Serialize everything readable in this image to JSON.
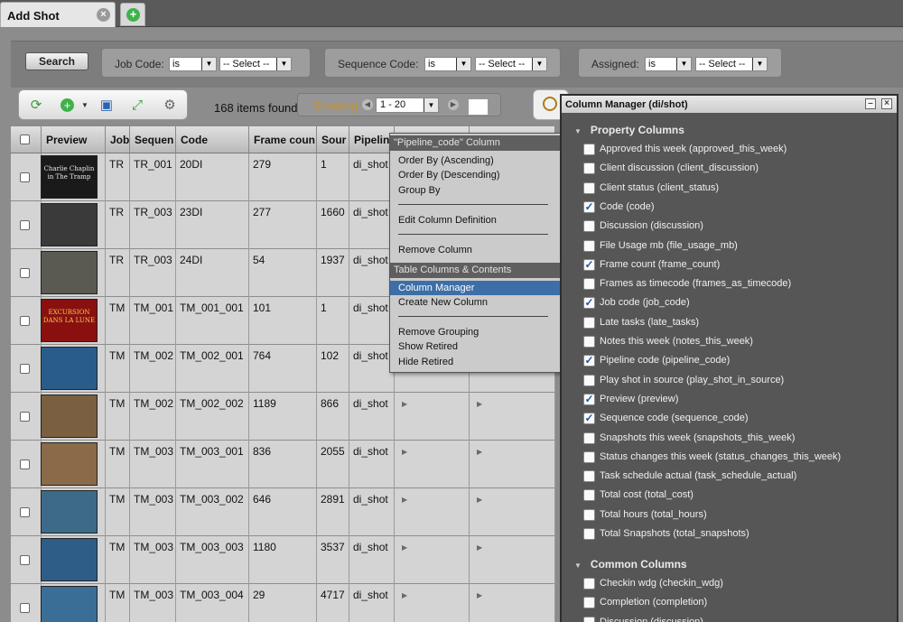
{
  "tabs": {
    "active_label": "Add Shot",
    "close_glyph": "×",
    "add_glyph": "+"
  },
  "search": {
    "button_label": "Search",
    "filters": [
      {
        "label": "Job Code:",
        "op": "is",
        "value": "-- Select --"
      },
      {
        "label": "Sequence Code:",
        "op": "is",
        "value": "-- Select --"
      },
      {
        "label": "Assigned:",
        "op": "is",
        "value": "-- Select --"
      }
    ]
  },
  "toolbar": {
    "items_found": "168 items found",
    "showing_label": "Showing",
    "range": "1 - 20",
    "icons": [
      "refresh-icon",
      "add-icon",
      "save-icon",
      "expand-icon",
      "gear-icon"
    ]
  },
  "table": {
    "headers": [
      "Preview",
      "Job",
      "Sequen",
      "Code",
      "Frame coun",
      "Sour",
      "Pipelin"
    ],
    "rows": [
      {
        "job": "TR",
        "seq": "TR_001",
        "code": "20DI",
        "frames": "279",
        "source": "1",
        "pipeline": "di_shot",
        "thumb": "#1a1a1a"
      },
      {
        "job": "TR",
        "seq": "TR_003",
        "code": "23DI",
        "frames": "277",
        "source": "1660",
        "pipeline": "di_shot",
        "thumb": "#3a3a3a"
      },
      {
        "job": "TR",
        "seq": "TR_003",
        "code": "24DI",
        "frames": "54",
        "source": "1937",
        "pipeline": "di_shot",
        "thumb": "#5a5a52"
      },
      {
        "job": "TM",
        "seq": "TM_001",
        "code": "TM_001_001",
        "frames": "101",
        "source": "1",
        "pipeline": "di_shot",
        "thumb": "#8a1010"
      },
      {
        "job": "TM",
        "seq": "TM_002",
        "code": "TM_002_001",
        "frames": "764",
        "source": "102",
        "pipeline": "di_shot",
        "thumb": "#2a5c8a"
      },
      {
        "job": "TM",
        "seq": "TM_002",
        "code": "TM_002_002",
        "frames": "1189",
        "source": "866",
        "pipeline": "di_shot",
        "thumb": "#7a6040"
      },
      {
        "job": "TM",
        "seq": "TM_003",
        "code": "TM_003_001",
        "frames": "836",
        "source": "2055",
        "pipeline": "di_shot",
        "thumb": "#8a6a48"
      },
      {
        "job": "TM",
        "seq": "TM_003",
        "code": "TM_003_002",
        "frames": "646",
        "source": "2891",
        "pipeline": "di_shot",
        "thumb": "#3e6a8a"
      },
      {
        "job": "TM",
        "seq": "TM_003",
        "code": "TM_003_003",
        "frames": "1180",
        "source": "3537",
        "pipeline": "di_shot",
        "thumb": "#2e5e88"
      },
      {
        "job": "TM",
        "seq": "TM_003",
        "code": "TM_003_004",
        "frames": "29",
        "source": "4717",
        "pipeline": "di_shot",
        "thumb": "#3a6e96"
      }
    ],
    "thumb_captions": {
      "row0": "Charlie Chaplin in The Tramp",
      "row3": "EXCURSION DANS LA LUNE"
    }
  },
  "context_menu": {
    "header": "\"Pipeline_code\" Column",
    "items_a": [
      "Order By (Ascending)",
      "Order By (Descending)",
      "Group By"
    ],
    "item_edit": "Edit Column Definition",
    "item_remove": "Remove Column",
    "section2": "Table Columns & Contents",
    "item_cm": "Column Manager",
    "item_new": "Create New Column",
    "items_c": [
      "Remove Grouping",
      "Show Retired",
      "Hide Retired"
    ]
  },
  "column_manager": {
    "title": "Column Manager (di/shot)",
    "section_property": "Property Columns",
    "section_common": "Common Columns",
    "property": [
      {
        "label": "Approved this week (approved_this_week)",
        "checked": false
      },
      {
        "label": "Client discussion (client_discussion)",
        "checked": false
      },
      {
        "label": "Client status (client_status)",
        "checked": false
      },
      {
        "label": "Code (code)",
        "checked": true
      },
      {
        "label": "Discussion (discussion)",
        "checked": false
      },
      {
        "label": "File Usage mb (file_usage_mb)",
        "checked": false
      },
      {
        "label": "Frame count (frame_count)",
        "checked": true
      },
      {
        "label": "Frames as timecode (frames_as_timecode)",
        "checked": false
      },
      {
        "label": "Job code (job_code)",
        "checked": true
      },
      {
        "label": "Late tasks (late_tasks)",
        "checked": false
      },
      {
        "label": "Notes this week (notes_this_week)",
        "checked": false
      },
      {
        "label": "Pipeline code (pipeline_code)",
        "checked": true
      },
      {
        "label": "Play shot in source (play_shot_in_source)",
        "checked": false
      },
      {
        "label": "Preview (preview)",
        "checked": true
      },
      {
        "label": "Sequence code (sequence_code)",
        "checked": true
      },
      {
        "label": "Snapshots this week (snapshots_this_week)",
        "checked": false
      },
      {
        "label": "Status changes this week (status_changes_this_week)",
        "checked": false
      },
      {
        "label": "Task schedule actual (task_schedule_actual)",
        "checked": false
      },
      {
        "label": "Total cost (total_cost)",
        "checked": false
      },
      {
        "label": "Total hours (total_hours)",
        "checked": false
      },
      {
        "label": "Total Snapshots (total_snapshots)",
        "checked": false
      }
    ],
    "common": [
      {
        "label": "Checkin wdg (checkin_wdg)",
        "checked": false
      },
      {
        "label": "Completion (completion)",
        "checked": false
      },
      {
        "label": "Discussion (discussion)",
        "checked": false
      }
    ]
  }
}
